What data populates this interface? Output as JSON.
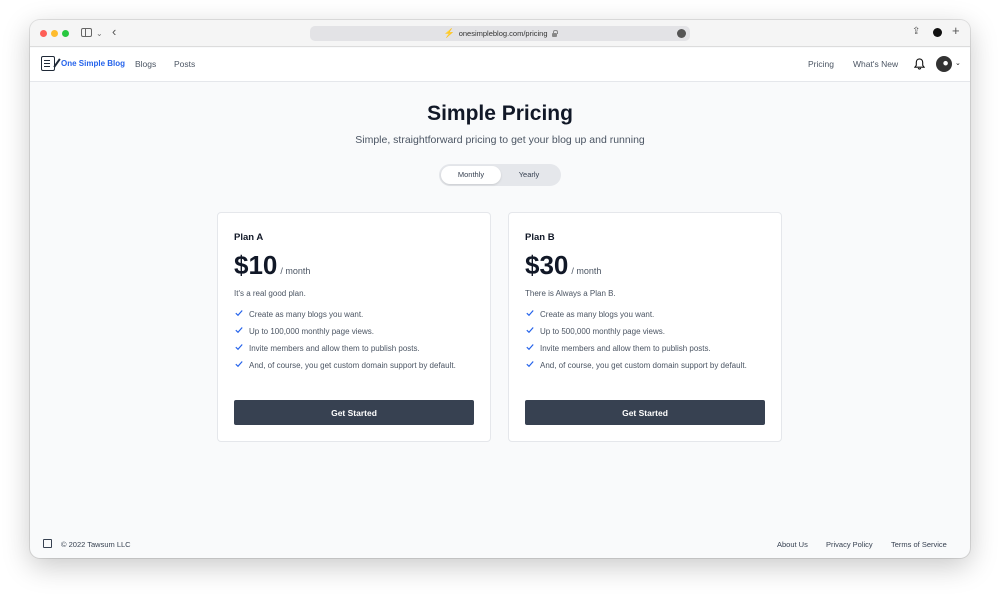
{
  "browser": {
    "url": "onesimpleblog.com/pricing"
  },
  "header": {
    "brand": "One Simple Blog",
    "nav_left": [
      "Blogs",
      "Posts"
    ],
    "nav_right": [
      "Pricing",
      "What's New"
    ]
  },
  "hero": {
    "title": "Simple Pricing",
    "subtitle": "Simple, straightforward pricing to get your blog up and running"
  },
  "billing_toggle": {
    "options": [
      "Monthly",
      "Yearly"
    ],
    "selected": "Monthly"
  },
  "plans": [
    {
      "name": "Plan A",
      "price": "$10",
      "period": "/ month",
      "description": "It's a real good plan.",
      "features": [
        "Create as many blogs you want.",
        "Up to 100,000 monthly page views.",
        "Invite members and allow them to publish posts.",
        "And, of course, you get custom domain support by default."
      ],
      "cta": "Get Started"
    },
    {
      "name": "Plan B",
      "price": "$30",
      "period": "/ month",
      "description": "There is Always a Plan B.",
      "features": [
        "Create as many blogs you want.",
        "Up to 500,000 monthly page views.",
        "Invite members and allow them to publish posts.",
        "And, of course, you get custom domain support by default."
      ],
      "cta": "Get Started"
    }
  ],
  "footer": {
    "copyright": "© 2022 Tawsum LLC",
    "links": [
      "About Us",
      "Privacy Policy",
      "Terms of Service"
    ]
  },
  "colors": {
    "brand": "#2563eb",
    "button": "#374151",
    "check": "#2563eb"
  },
  "icons": [
    "sidebar-icon",
    "back-icon",
    "bolt-icon",
    "lock-icon",
    "more-icon",
    "share-icon",
    "extension-icon",
    "new-tab-icon",
    "logo-icon",
    "bell-icon",
    "avatar",
    "check-icon"
  ]
}
